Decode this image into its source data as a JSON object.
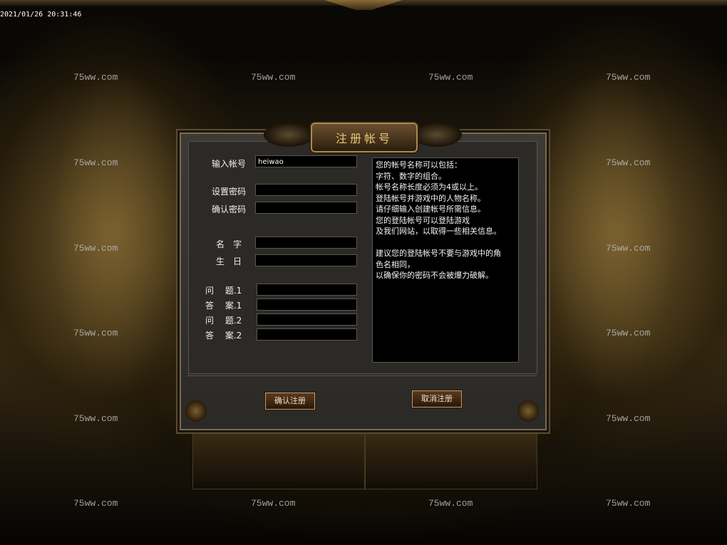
{
  "timestamp": "2021/01/26 20:31:46",
  "watermark": "75ww.com",
  "dialog": {
    "title": "注册帐号",
    "labels": {
      "account": "输入帐号",
      "password": "设置密码",
      "confirm_password": "确认密码",
      "name": "名　字",
      "birthday": "生　日",
      "question1": "问　 题.1",
      "answer1": "答　 案.1",
      "question2": "问　 题.2",
      "answer2": "答　 案.2"
    },
    "values": {
      "account": "heiwao",
      "password": "",
      "confirm_password": "",
      "name": "",
      "birthday": "",
      "question1": "",
      "answer1": "",
      "question2": "",
      "answer2": ""
    },
    "info_text": "您的帐号名称可以包括：\n字符、数字的组合。\n帐号名称长度必须为4或以上。\n登陆帐号并游戏中的人物名称。\n请仔细输入创建帐号所需信息。\n您的登陆帐号可以登陆游戏\n及我们网站，以取得一些相关信息。\n\n建议您的登陆帐号不要与游戏中的角\n色名相同，\n以确保你的密码不会被爆力破解。",
    "buttons": {
      "confirm": "确认注册",
      "cancel": "取消注册"
    }
  }
}
